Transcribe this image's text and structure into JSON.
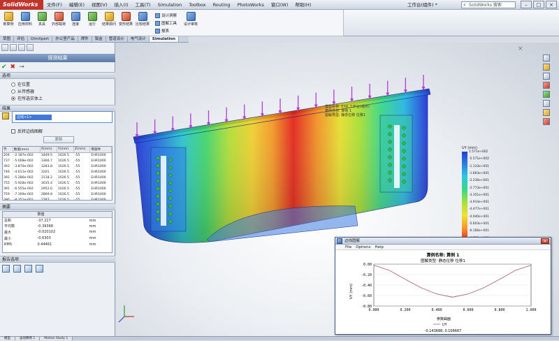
{
  "app": {
    "logo": "SolidWorks",
    "menus": [
      "文件(F)",
      "编辑(E)",
      "视图(V)",
      "插入(I)",
      "工具(T)",
      "Simulation",
      "Toolbox",
      "Routing",
      "PhotoWorks",
      "窗口(W)",
      "帮助(H)"
    ],
    "doc_title": "工作台(组件) *",
    "search_placeholder": "SolidWorks 搜索"
  },
  "ribbon": {
    "buttons": [
      "新算例",
      "应用材料",
      "夹具",
      "外部载荷",
      "连接",
      "运行",
      "结果顾问",
      "变形结果",
      "比较结果",
      "图解工具",
      "报表"
    ],
    "small": [
      "设计洞察",
      "图解工具",
      "报表",
      "设计审核"
    ]
  },
  "tabs": [
    "草图",
    "评估",
    "DimXpert",
    "办公室产品",
    "焊件",
    "钣金",
    "管道设计",
    "电气设计",
    "Simulation"
  ],
  "tabs_active": "Simulation",
  "probe": {
    "header": "探测结果",
    "options_title": "选项",
    "options": [
      "在位置",
      "从传感器",
      "在所选实体上"
    ],
    "options_selected": 2,
    "results_title": "结果",
    "selection_label": "边线<1>",
    "flip_label": "反转边线图解",
    "update_label": "更新",
    "table_headers": [
      "节",
      "数值(mm)",
      "X(mm)",
      "Y(mm)",
      "Z(mm)",
      "零部件"
    ],
    "table_rows": [
      [
        "204",
        "-2.187e-002",
        "3449.5",
        "1026.5",
        "-55",
        "EHR1000"
      ],
      [
        "737",
        "-5.008e-002",
        "3366.7",
        "1026.5",
        "-55",
        "EHR1000"
      ],
      [
        "393",
        "-3.870e-002",
        "3283.8",
        "1026.5",
        "-55",
        "EHR1000"
      ],
      [
        "746",
        "-4.611e-002",
        "3201",
        "1026.5",
        "-55",
        "EHR1000"
      ],
      [
        "392",
        "-5.286e-002",
        "3118.2",
        "1026.5",
        "-55",
        "EHR1000"
      ],
      [
        "755",
        "-5.928e-002",
        "3035.4",
        "1026.5",
        "-55",
        "EHR1000"
      ],
      [
        "391",
        "-6.555e-002",
        "2952.6",
        "1026.5",
        "-55",
        "EHR1000"
      ],
      [
        "759",
        "-7.169e-002",
        "2869.8",
        "1026.5",
        "-55",
        "EHR1000"
      ],
      [
        "390",
        "-8.351e-002",
        "2787",
        "1026.5",
        "-55",
        "EHR1000"
      ]
    ],
    "summary_title": "摘要",
    "summary_headers": [
      "",
      "数值",
      ""
    ],
    "summary_rows": [
      [
        "总和",
        "-37.217",
        "mm"
      ],
      [
        "平均数",
        "-0.39368",
        "mm"
      ],
      [
        "最大",
        "-0.020102",
        "mm"
      ],
      [
        "最小",
        "-0.6303",
        "mm"
      ],
      [
        "RMS",
        "0.44461",
        "mm"
      ]
    ],
    "report_title": "报告选项"
  },
  "viewport": {
    "note": "模型名称: EXR 工作台(组件)\n算例名称: 算例 1\n图解类型: 静态位移 位移1",
    "legend_title": "UY (mm)",
    "legend_labels": [
      "1.571e+002",
      "-5.571e+002",
      "-1.133e+001",
      "-1.663e+001",
      "-2.236e+001",
      "-2.773e+001",
      "-3.351e+001",
      "-3.914e+001",
      "-4.477e+001",
      "-4.940e+001",
      "-5.603e+001",
      "-6.166e+001",
      "-6.729e+001"
    ],
    "colors": {
      "max_red": "#e42a20",
      "min_blue": "#2a3bd8",
      "arrow": "#b13bd6"
    }
  },
  "graph": {
    "title": "边线图解",
    "menus": [
      "File",
      "Options",
      "Help"
    ],
    "chart_title": "算例名称: 算例 1",
    "chart_subtitle": "图解类型: 静态位移 位移1",
    "ylabel": "UY (mm)",
    "xlabel": "参数曲面",
    "legend": "UY",
    "cursor_readout": "-0.143688, 0.106667"
  },
  "chart_data": {
    "type": "line",
    "title": "算例名称: 算例 1",
    "subtitle": "图解类型: 静态位移 位移1",
    "xlabel": "参数曲面",
    "ylabel": "UY (mm)",
    "xlim": [
      0.0,
      1.0
    ],
    "ylim": [
      -0.8,
      0.0
    ],
    "x_ticks": [
      "0.000",
      "0.200",
      "0.400",
      "0.600",
      "0.800",
      "1.000"
    ],
    "y_ticks": [
      "0.00",
      "-0.20",
      "-0.40",
      "-0.60",
      "-0.80"
    ],
    "series": [
      {
        "name": "UY",
        "x": [
          0.0,
          0.1,
          0.2,
          0.3,
          0.4,
          0.5,
          0.6,
          0.7,
          0.8,
          0.9,
          1.0
        ],
        "y": [
          -0.02,
          -0.12,
          -0.29,
          -0.45,
          -0.57,
          -0.63,
          -0.57,
          -0.45,
          -0.29,
          -0.12,
          -0.02
        ]
      }
    ]
  },
  "status": [
    "模型",
    "运动算例 1",
    "Motion Study 1"
  ]
}
